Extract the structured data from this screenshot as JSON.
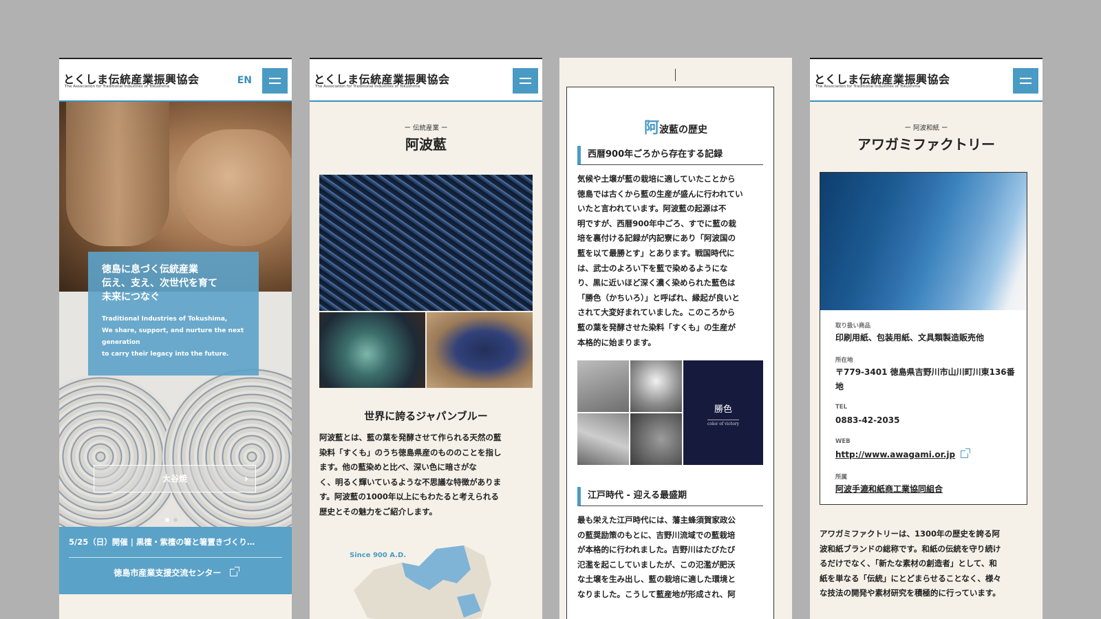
{
  "brand": {
    "logo_ja": "とくしま伝統産業振興協会",
    "logo_en": "The Association for Traditional Industries of Tokushima"
  },
  "colors": {
    "accent": "#4a9bc4",
    "background": "#f5f1e8",
    "frame": "#b1b1b1",
    "victory_panel": "#161b3e"
  },
  "screen1": {
    "lang_link": "EN",
    "hero_ja": [
      "徳島に息づく伝統産業",
      "伝え、支え、次世代を育て",
      "未来につなぐ"
    ],
    "hero_en": [
      "Traditional Industries of Tokushima,",
      "We share, support, and nurture the next",
      "generation",
      "to carry their legacy into the future."
    ],
    "slide_label": "大谷焼",
    "news_text": "5/25（日）開催 | 黒檀・紫檀の箸と箸置きづくり…",
    "news_link": "徳島市産業支援交流センター"
  },
  "screen2": {
    "kicker": "ー 伝統産業 ー",
    "title": "阿波藍",
    "subheading": "世界に誇るジャパンブルー",
    "body": [
      "阿波藍とは、藍の葉を発酵させて作られる天然の藍",
      "染料「すくも」のうち徳島県産のもののことを指し",
      "ます。他の藍染めと比べ、深い色に暗さがな",
      "く、明るく輝いているような不思議な特徴がありま",
      "す。阿波藍の1000年以上にもわたると考えられる",
      "歴史とその魅力をご紹介します。"
    ],
    "map_label": "Since 900 A.D."
  },
  "screen3": {
    "title_big": "阿",
    "title_rest": "波藍の歴史",
    "section1": "西暦900年ごろから存在する記録",
    "body1": [
      "気候や土壌が藍の栽培に適していたことから",
      "徳島では古くから藍の生産が盛んに行われてい",
      "いたと言われています。阿波藍の起源は不",
      "明ですが、西暦900年中ごろ、すでに藍の栽",
      "培を裏付ける記録が内記寮にあり「阿波国の",
      "藍を以て最勝とす」とあります。戦国時代に",
      "は、武士のよろい下を藍で染めるようにな",
      "り、黒に近いほど深く濃く染められた藍色は",
      "「勝色（かちいろ）」と呼ばれ、縁起が良いと",
      "されて大変好まれていました。このころから",
      "藍の葉を発酵させた染料「すくも」の生産が",
      "本格的に始まります。"
    ],
    "victory_ja": "勝色",
    "victory_en": "color of victory",
    "section2": "江戸時代 - 迎える最盛期",
    "body2": [
      "最も栄えた江戸時代には、藩主蜂須賀家政公",
      "の藍奨励策のもとに、吉野川流域での藍栽培",
      "が本格的に行われました。吉野川はたびたび",
      "氾濫を起こしていましたが、この氾濫が肥沃",
      "な土壌を生み出し、藍の栽培に適した環境と",
      "なりました。こうして藍産地が形成され、阿"
    ]
  },
  "screen4": {
    "kicker": "ー 阿波和紙 ー",
    "title": "アワガミファクトリー",
    "fields": [
      {
        "label": "取り扱い商品",
        "value": "印刷用紙、包装用紙、文具類製造販売他"
      },
      {
        "label": "所在地",
        "value": "〒779-3401 徳島県吉野川市山川町川東136番地"
      },
      {
        "label": "TEL",
        "value": "0883-42-2035"
      },
      {
        "label": "WEB",
        "value": "http://www.awagami.or.jp"
      },
      {
        "label": "所属",
        "value": "阿波手漉和紙商工業協同組合"
      }
    ],
    "body": [
      "アワガミファクトリーは、1300年の歴史を誇る阿",
      "波和紙ブランドの総称です。和紙の伝統を守り続け",
      "るだけでなく、「新たな素材の創造者」として、和",
      "紙を単なる「伝統」にとどまらせることなく、様々",
      "な技法の開発や素材研究を積極的に行っています。"
    ]
  }
}
